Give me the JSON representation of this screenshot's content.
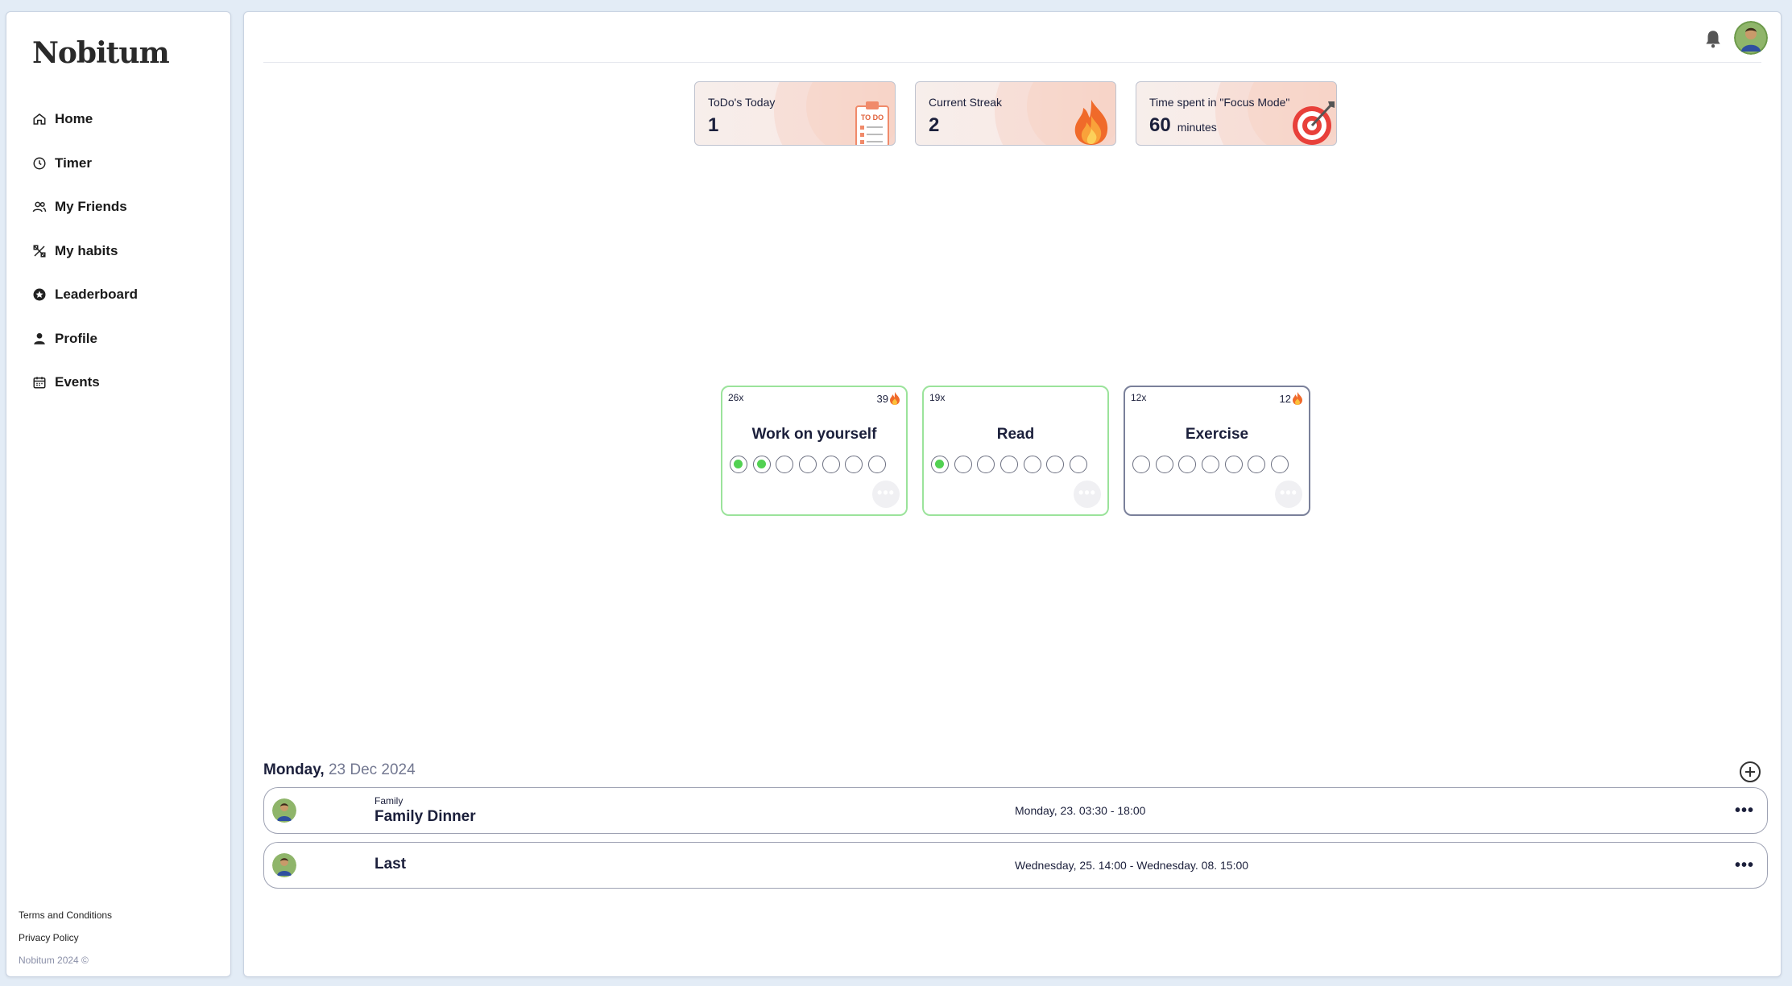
{
  "app": {
    "logo": "Nobitum"
  },
  "sidebar": {
    "items": [
      {
        "label": "Home",
        "icon": "home-icon"
      },
      {
        "label": "Timer",
        "icon": "clock-icon"
      },
      {
        "label": "My Friends",
        "icon": "people-icon"
      },
      {
        "label": "My habits",
        "icon": "habits-icon"
      },
      {
        "label": "Leaderboard",
        "icon": "star-badge-icon"
      },
      {
        "label": "Profile",
        "icon": "person-icon"
      },
      {
        "label": "Events",
        "icon": "calendar-icon"
      }
    ],
    "footer": {
      "terms": "Terms and Conditions",
      "privacy": "Privacy Policy",
      "copyright": "Nobitum 2024 ©"
    }
  },
  "stats": [
    {
      "label": "ToDo's Today",
      "value": "1",
      "unit": "",
      "illustration": "todo-clipboard-icon"
    },
    {
      "label": "Current Streak",
      "value": "2",
      "unit": "",
      "illustration": "fire-icon"
    },
    {
      "label": "Time spent in \"Focus Mode\"",
      "value": "60",
      "unit": "minutes",
      "illustration": "target-icon"
    }
  ],
  "habits": [
    {
      "name": "Work on yourself",
      "count": "26x",
      "streak": "39",
      "done": [
        true,
        true,
        false,
        false,
        false,
        false,
        false
      ]
    },
    {
      "name": "Read",
      "count": "19x",
      "streak": "",
      "done": [
        true,
        false,
        false,
        false,
        false,
        false,
        false
      ]
    },
    {
      "name": "Exercise",
      "count": "12x",
      "streak": "12",
      "done": [
        false,
        false,
        false,
        false,
        false,
        false,
        false
      ]
    }
  ],
  "events_section": {
    "day": "Monday,",
    "date": "23 Dec 2024",
    "events": [
      {
        "category": "Family",
        "title": "Family Dinner",
        "time": "Monday, 23. 03:30 - 18:00"
      },
      {
        "category": "",
        "title": "Last",
        "time": "Wednesday, 25. 14:00 - Wednesday. 08. 15:00"
      }
    ]
  },
  "colors": {
    "accent_green": "#52d152",
    "habit_border_active": "#9be39b",
    "text_dark": "#1b1f3b"
  }
}
